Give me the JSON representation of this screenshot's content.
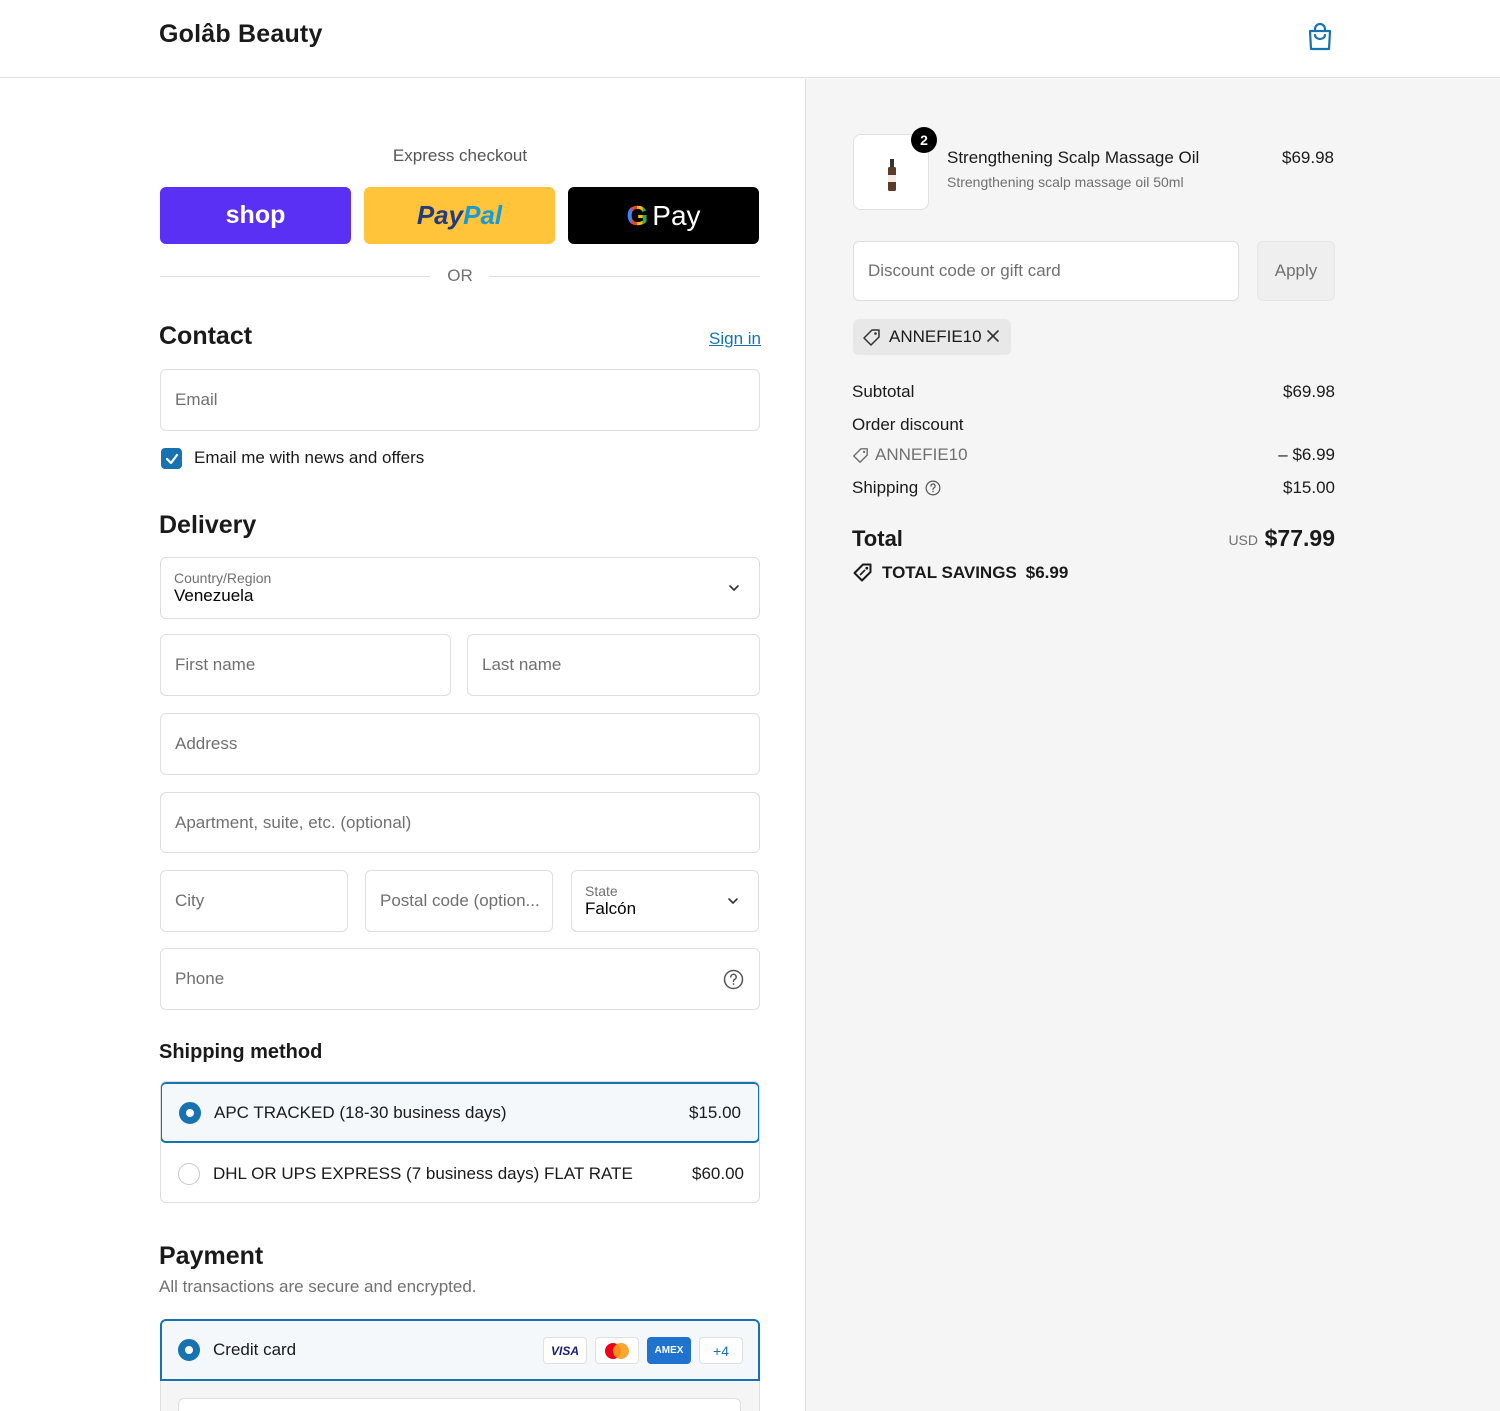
{
  "header": {
    "brand": "Golâb Beauty",
    "cart_icon": "shopping-bag-icon"
  },
  "express": {
    "label": "Express checkout",
    "shop_label": "shop",
    "paypal_part1": "Pay",
    "paypal_part2": "Pal",
    "gpay_g": "G",
    "gpay_label": "Pay",
    "or": "OR",
    "colors": {
      "shop": "#5a31f4",
      "paypal": "#ffc439",
      "gpay": "#000000"
    }
  },
  "contact": {
    "heading": "Contact",
    "sign_in": "Sign in",
    "email_placeholder": "Email",
    "newsletter_label": "Email me with news and offers",
    "newsletter_checked": true
  },
  "delivery": {
    "heading": "Delivery",
    "country_label": "Country/Region",
    "country_value": "Venezuela",
    "first_name": "First name",
    "last_name": "Last name",
    "address": "Address",
    "apartment": "Apartment, suite, etc. (optional)",
    "city": "City",
    "postal": "Postal code (option...",
    "state_label": "State",
    "state_value": "Falcón",
    "phone": "Phone"
  },
  "shipping": {
    "heading": "Shipping method",
    "options": [
      {
        "label": "APC TRACKED (18-30 business days)",
        "price": "$15.00",
        "selected": true
      },
      {
        "label": "DHL OR UPS EXPRESS (7 business days) FLAT RATE",
        "price": "$60.00",
        "selected": false
      }
    ]
  },
  "payment": {
    "heading": "Payment",
    "subtitle": "All transactions are secure and encrypted.",
    "method": "Credit card",
    "cards": [
      "VISA",
      "AMEX"
    ],
    "more_cards": "+4",
    "accent": "#1773b0"
  },
  "summary": {
    "product": {
      "name": "Strengthening Scalp Massage Oil",
      "variant": "Strengthening scalp massage oil 50ml",
      "price": "$69.98",
      "quantity": "2"
    },
    "discount_placeholder": "Discount code or gift card",
    "apply": "Apply",
    "applied_code": "ANNEFIE10",
    "subtotal_label": "Subtotal",
    "subtotal": "$69.98",
    "order_discount_label": "Order discount",
    "discount_code": "ANNEFIE10",
    "discount_amount": "– $6.99",
    "shipping_label": "Shipping",
    "shipping": "$15.00",
    "total_label": "Total",
    "currency": "USD",
    "total": "$77.99",
    "savings_label": "TOTAL SAVINGS",
    "savings": "$6.99"
  }
}
